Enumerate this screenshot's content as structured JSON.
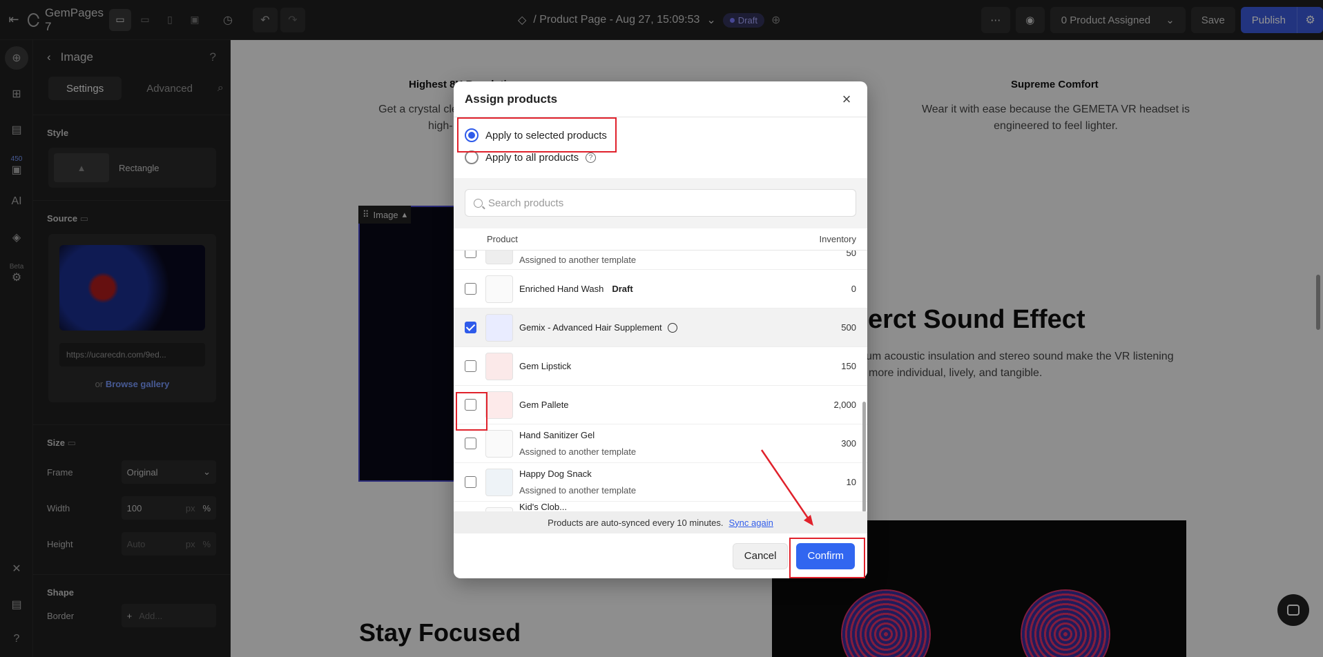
{
  "app": {
    "brand": "GemPages 7",
    "page_title": "/ Product Page - Aug 27, 15:09:53",
    "status_badge": "Draft",
    "product_assigned": "0 Product Assigned",
    "save_label": "Save",
    "publish_label": "Publish"
  },
  "rail": {
    "badge_450": "450",
    "ai_label": "AI",
    "beta_label": "Beta"
  },
  "panel": {
    "title": "Image",
    "tabs": [
      "Settings",
      "Advanced"
    ],
    "style_label": "Style",
    "style_value": "Rectangle",
    "source_label": "Source",
    "source_url": "https://ucarecdn.com/9ed...",
    "or_label": "or",
    "browse_label": "Browse gallery",
    "size_label": "Size",
    "frame_label": "Frame",
    "frame_value": "Original",
    "width_label": "Width",
    "width_value": "100",
    "width_unit_px": "px",
    "width_unit_pct": "%",
    "height_label": "Height",
    "height_placeholder": "Auto",
    "shape_label": "Shape",
    "border_label": "Border",
    "border_add": "Add..."
  },
  "canvas": {
    "heading_left": "Highest 8K Resolution",
    "text_left_1": "Get a crystal clear view with two 4K",
    "text_left_2": "high-",
    "heading_right": "Supreme Comfort",
    "text_right_1": "Wear it with ease because the GEMETA VR headset is",
    "text_right_2": "engineered to feel lighter.",
    "big_heading": "erct Sound Effect",
    "sound_text_1": "um acoustic insulation and stereo sound make the VR listening",
    "sound_text_2": "more individual, lively, and tangible.",
    "stay_focused": "Stay Focused",
    "image_toolbar": "Image"
  },
  "modal": {
    "title": "Assign products",
    "radio_selected": "Apply to selected products",
    "radio_all": "Apply to all products",
    "search_placeholder": "Search products",
    "col_product": "Product",
    "col_inventory": "Inventory",
    "items": [
      {
        "name": "",
        "sub": "Assigned to another template",
        "inventory": "50",
        "checked": false
      },
      {
        "name": "Enriched Hand Wash",
        "tag": "Draft",
        "sub": "",
        "inventory": "0",
        "checked": false
      },
      {
        "name": "Gemix - Advanced Hair Supplement",
        "sub": "",
        "inventory": "500",
        "checked": true
      },
      {
        "name": "Gem Lipstick",
        "sub": "",
        "inventory": "150",
        "checked": false
      },
      {
        "name": "Gem Pallete",
        "sub": "",
        "inventory": "2,000",
        "checked": false
      },
      {
        "name": "Hand Sanitizer Gel",
        "sub": "Assigned to another template",
        "inventory": "300",
        "checked": false
      },
      {
        "name": "Happy Dog Snack",
        "sub": "Assigned to another template",
        "inventory": "10",
        "checked": false
      },
      {
        "name": "Kid's Clob...",
        "sub": "",
        "inventory": "",
        "checked": false
      }
    ],
    "sync_text": "Products are auto-synced every 10 minutes.",
    "sync_link": "Sync again",
    "cancel_label": "Cancel",
    "confirm_label": "Confirm"
  },
  "colors": {
    "accent": "#3166f0",
    "highlight": "#e0212b",
    "dark_bg": "#1f1f1f"
  }
}
